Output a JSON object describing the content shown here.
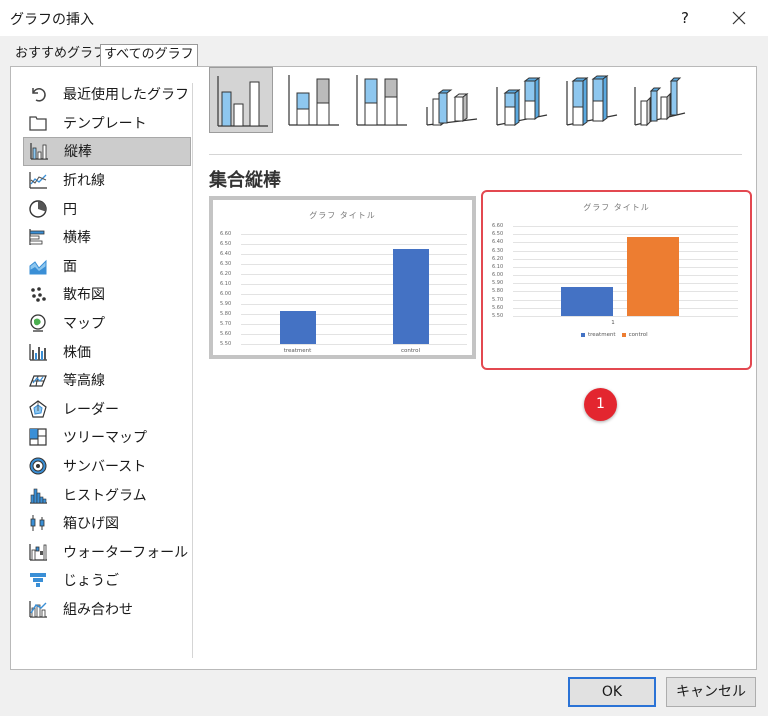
{
  "window": {
    "title": "グラフの挿入",
    "help_label": "?"
  },
  "tabs": [
    {
      "label": "おすすめグラフ"
    },
    {
      "label": "すべてのグラフ"
    }
  ],
  "sidebar": {
    "items": [
      {
        "label": "最近使用したグラフ",
        "icon": "undo-icon"
      },
      {
        "label": "テンプレート",
        "icon": "folder-icon"
      },
      {
        "label": "縦棒",
        "icon": "column-chart-icon"
      },
      {
        "label": "折れ線",
        "icon": "line-chart-icon"
      },
      {
        "label": "円",
        "icon": "pie-chart-icon"
      },
      {
        "label": "横棒",
        "icon": "bar-chart-icon"
      },
      {
        "label": "面",
        "icon": "area-chart-icon"
      },
      {
        "label": "散布図",
        "icon": "scatter-chart-icon"
      },
      {
        "label": "マップ",
        "icon": "map-chart-icon"
      },
      {
        "label": "株価",
        "icon": "stock-chart-icon"
      },
      {
        "label": "等高線",
        "icon": "surface-chart-icon"
      },
      {
        "label": "レーダー",
        "icon": "radar-chart-icon"
      },
      {
        "label": "ツリーマップ",
        "icon": "treemap-icon"
      },
      {
        "label": "サンバースト",
        "icon": "sunburst-icon"
      },
      {
        "label": "ヒストグラム",
        "icon": "histogram-icon"
      },
      {
        "label": "箱ひげ図",
        "icon": "box-whisker-icon"
      },
      {
        "label": "ウォーターフォール",
        "icon": "waterfall-icon"
      },
      {
        "label": "じょうご",
        "icon": "funnel-icon"
      },
      {
        "label": "組み合わせ",
        "icon": "combo-chart-icon"
      }
    ]
  },
  "main": {
    "heading": "集合縦棒",
    "badge": "1"
  },
  "chart_data": [
    {
      "type": "bar",
      "title": "グラフ タイトル",
      "categories": [
        "treatment",
        "control"
      ],
      "values": [
        5.83,
        6.45
      ],
      "ylim": [
        5.5,
        6.6
      ],
      "yticks": [
        "6.60",
        "6.50",
        "6.40",
        "6.30",
        "6.20",
        "6.10",
        "6.00",
        "5.90",
        "5.80",
        "5.70",
        "5.60",
        "5.50"
      ],
      "bar_color": "#4472c4",
      "grid": true
    },
    {
      "type": "bar",
      "title": "グラフ タイトル",
      "categories": [
        "1"
      ],
      "series": [
        {
          "name": "treatment",
          "values": [
            5.85
          ],
          "color": "#4472c4"
        },
        {
          "name": "control",
          "values": [
            6.47
          ],
          "color": "#ed7d31"
        }
      ],
      "ylim": [
        5.5,
        6.6
      ],
      "yticks": [
        "6.60",
        "6.50",
        "6.40",
        "6.30",
        "6.20",
        "6.10",
        "6.00",
        "5.90",
        "5.80",
        "5.70",
        "5.60",
        "5.50"
      ],
      "legend": "bottom",
      "grid": true
    }
  ],
  "buttons": {
    "ok": "OK",
    "cancel": "キャンセル"
  }
}
